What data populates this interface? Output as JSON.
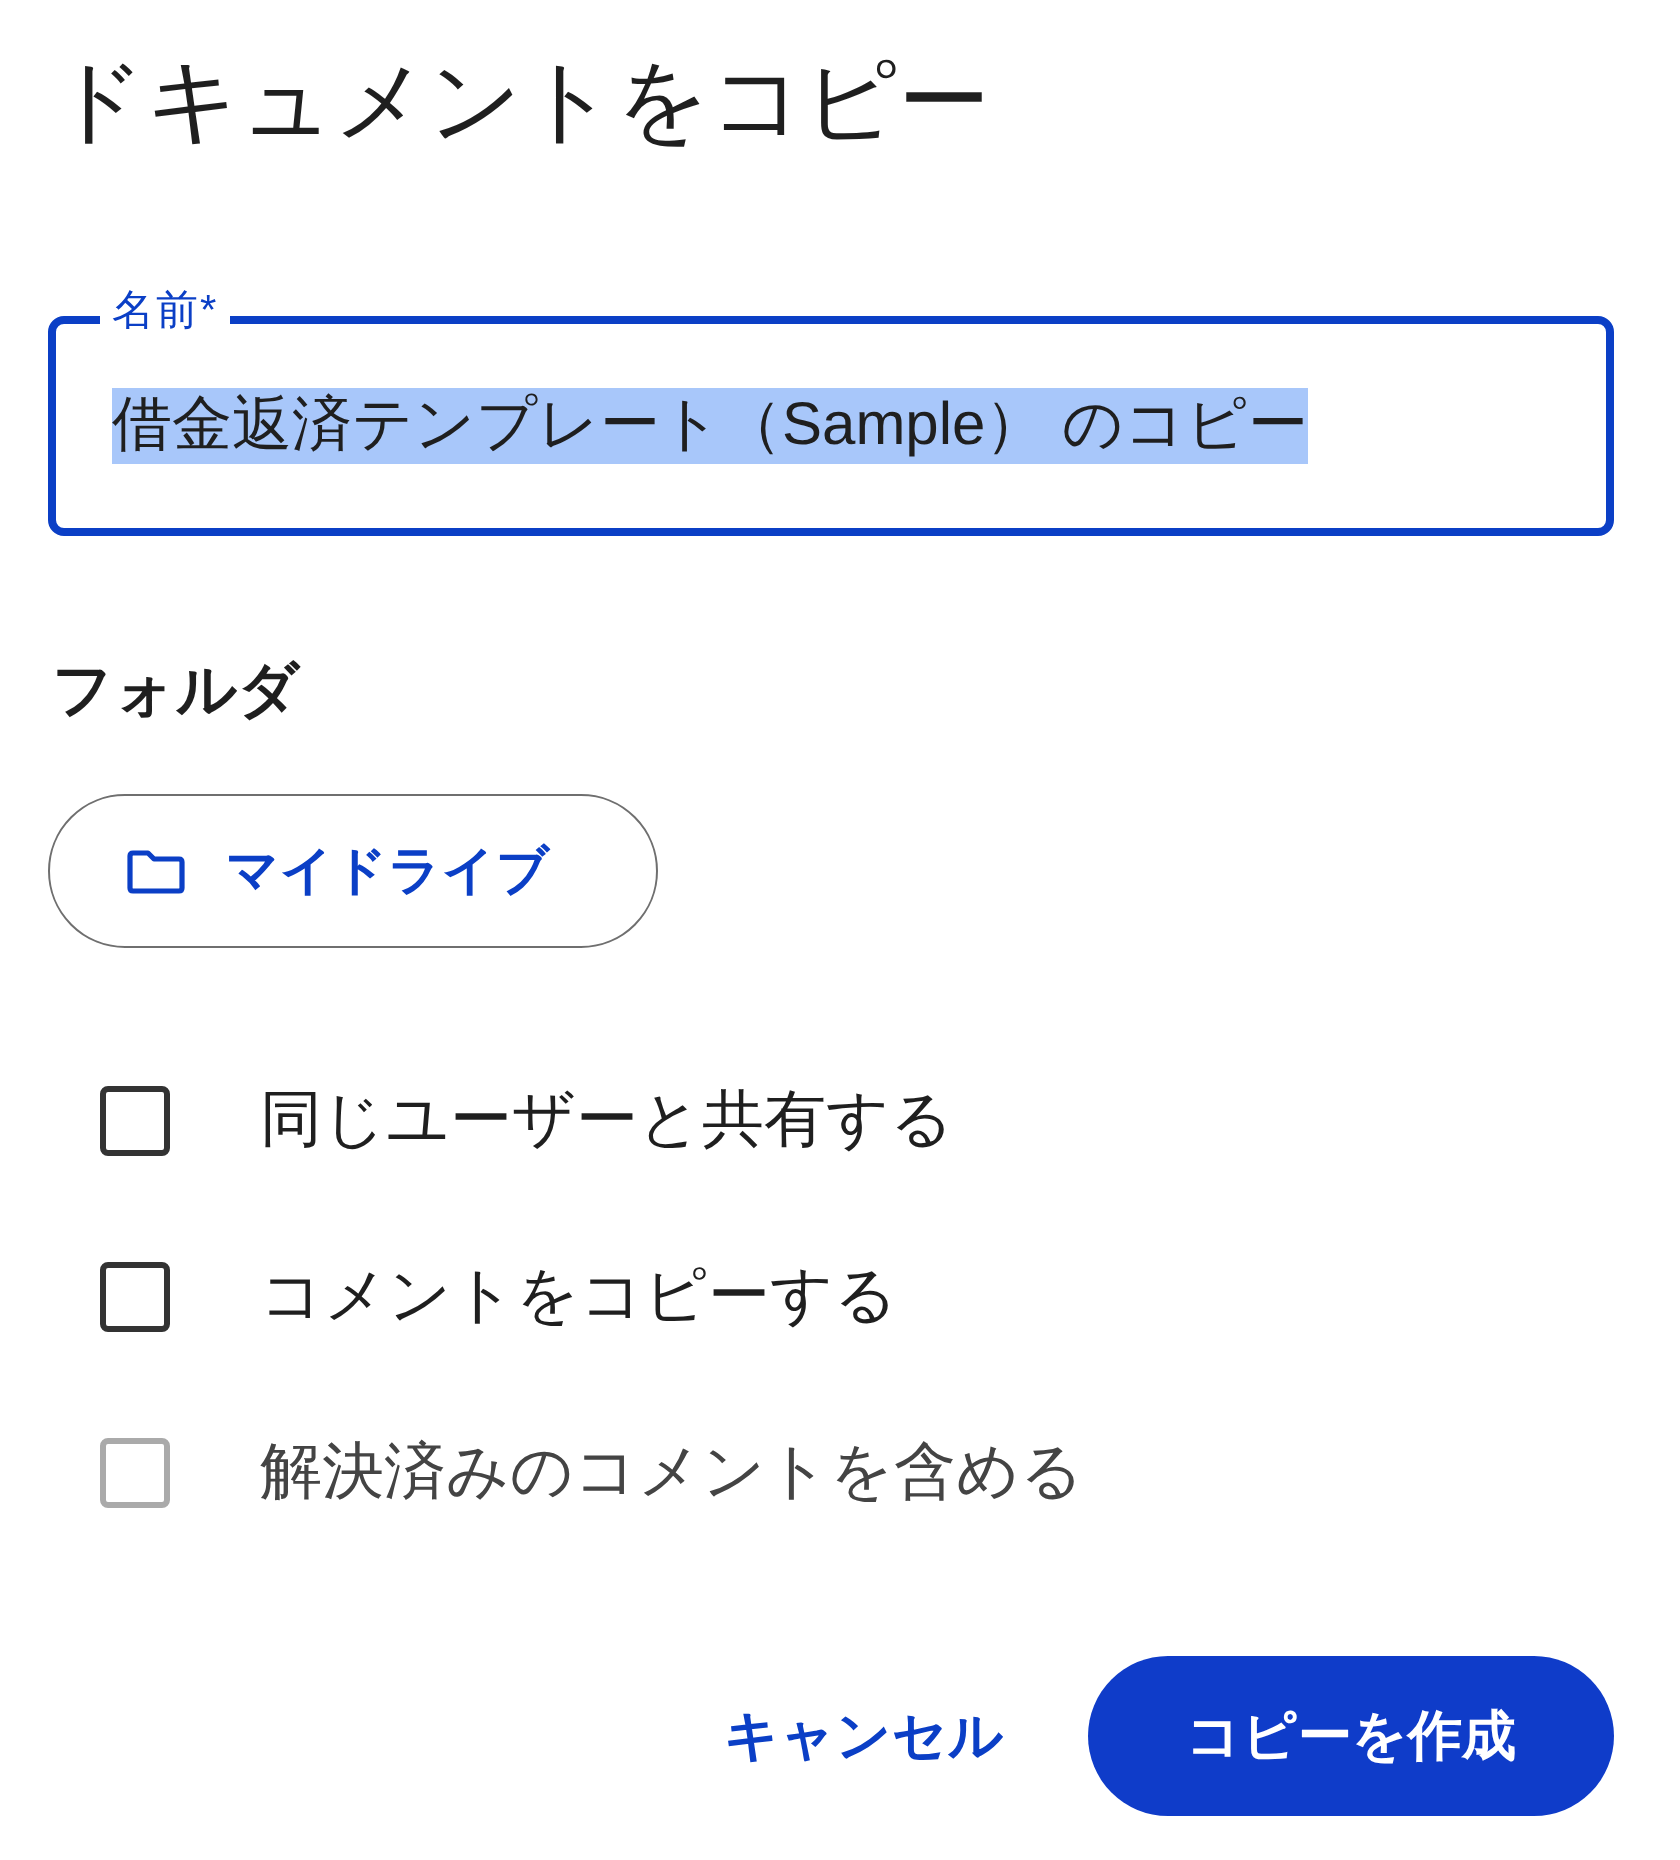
{
  "dialog": {
    "title": "ドキュメントをコピー"
  },
  "name_field": {
    "label": "名前*",
    "value": "借金返済テンプレート（Sample） のコピー",
    "focused": true,
    "text_selected": true
  },
  "folder": {
    "heading": "フォルダ",
    "button": "マイドライブ"
  },
  "options": [
    {
      "label": "同じユーザーと共有する",
      "checked": false,
      "disabled": false
    },
    {
      "label": "コメントをコピーする",
      "checked": false,
      "disabled": false
    },
    {
      "label": "解決済みのコメントを含める",
      "checked": false,
      "disabled": true
    }
  ],
  "buttons": [
    {
      "label": "キャンセル",
      "kind": "text"
    },
    {
      "label": "コピーを作成",
      "kind": "filled"
    }
  ]
}
